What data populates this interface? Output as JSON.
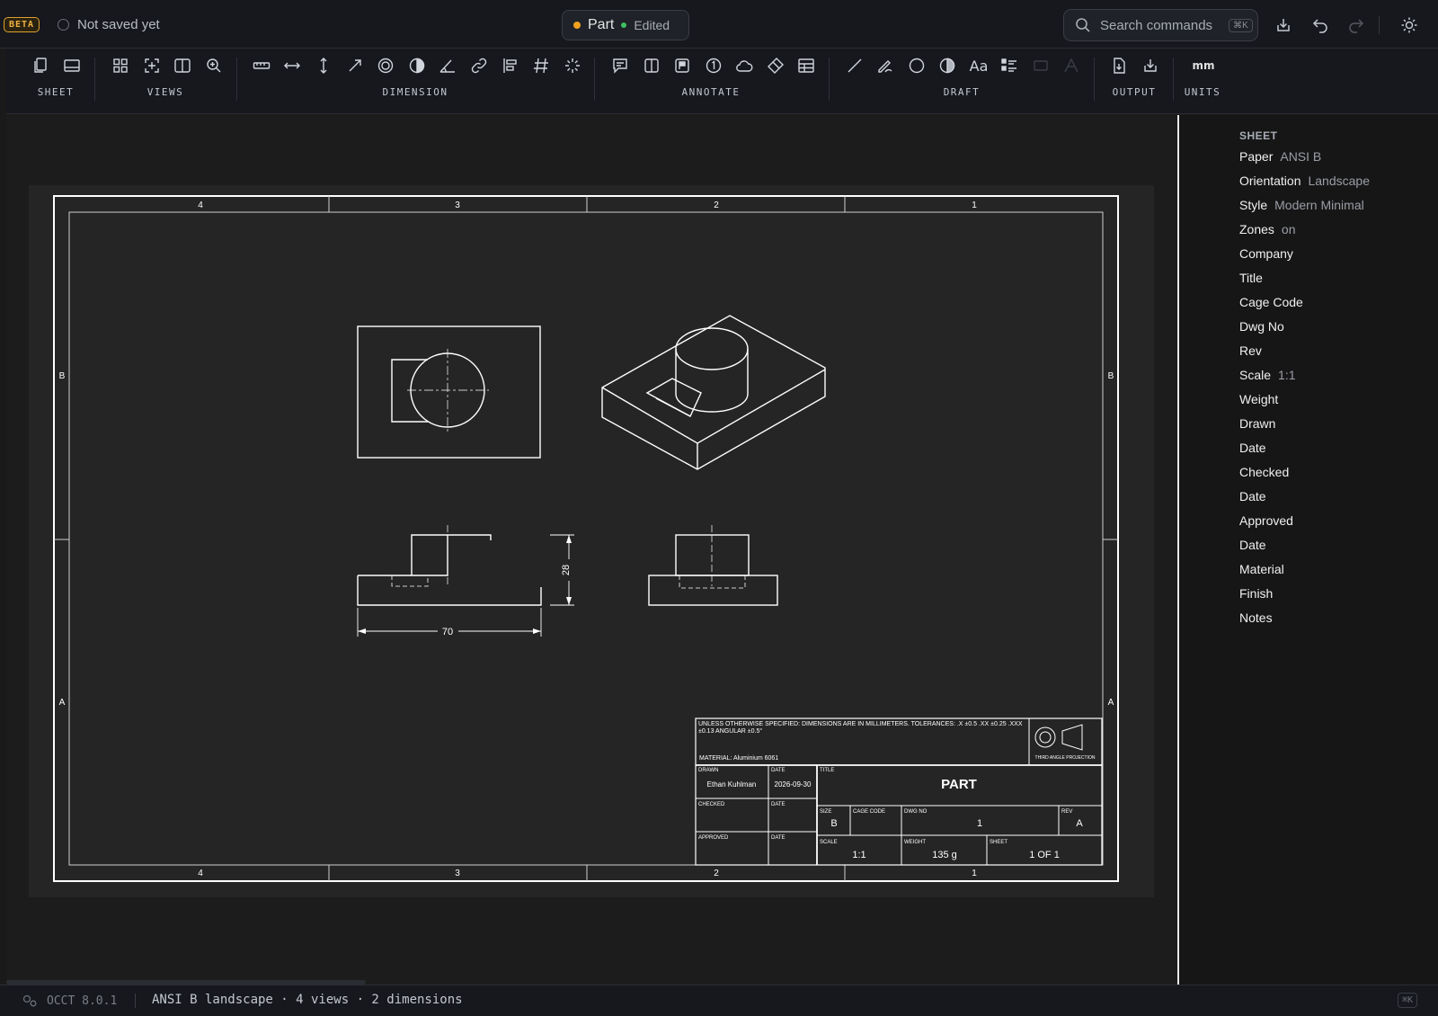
{
  "topbar": {
    "beta": "BETA",
    "save_status": "Not saved yet",
    "doc_name": "Part",
    "doc_state": "Edited",
    "search_placeholder": "Search commands",
    "search_shortcut": "⌘K",
    "icons": [
      "import-icon",
      "undo-icon",
      "redo-icon",
      "theme-icon"
    ]
  },
  "ribbon": {
    "groups": [
      {
        "label": "SHEET",
        "icons": [
          "new-sheet-icon",
          "titleblock-icon"
        ]
      },
      {
        "label": "VIEWS",
        "icons": [
          "base-views-icon",
          "projected-view-icon",
          "section-view-icon",
          "detail-view-icon"
        ]
      },
      {
        "label": "DIMENSION",
        "icons": [
          "linear-dim-icon",
          "horizontal-dim-icon",
          "vertical-dim-icon",
          "radius-dim-icon",
          "diameter-dim-icon",
          "half-dim-icon",
          "angle-dim-icon",
          "chain-dim-icon",
          "baseline-dim-icon",
          "ordinate-dim-icon",
          "auto-dim-icon"
        ]
      },
      {
        "label": "ANNOTATE",
        "icons": [
          "note-icon",
          "split-icon",
          "flag-icon",
          "balloon-icon",
          "cloud-icon",
          "tag-icon",
          "table-icon"
        ]
      },
      {
        "label": "DRAFT",
        "icons": [
          "line-icon",
          "sketch-icon",
          "circle-icon",
          "fill-icon",
          "text-icon",
          "list-icon",
          "disabled-a-icon",
          "disabled-b-icon"
        ]
      },
      {
        "label": "OUTPUT",
        "icons": [
          "export-pdf-icon",
          "download-icon"
        ]
      },
      {
        "label": "UNITS",
        "value": "mm"
      }
    ]
  },
  "sheet": {
    "zones_cols": [
      "4",
      "3",
      "2",
      "1"
    ],
    "zones_rows": [
      "B",
      "A"
    ],
    "dim_width": "70",
    "dim_height": "28",
    "titleblock": {
      "notes": "UNLESS OTHERWISE SPECIFIED: DIMENSIONS ARE IN MILLIMETERS. TOLERANCES: .X ±0.5 .XX ±0.25 .XXX ±0.13 ANGULAR ±0.5°",
      "material": "MATERIAL: Aluminium 6061",
      "projection": "THIRD ANGLE PROJECTION",
      "drawn_label": "DRAWN",
      "drawn_value": "Ethan Kuhlman",
      "date_label": "DATE",
      "date_value": "2026-09-30",
      "checked_label": "CHECKED",
      "approved_label": "APPROVED",
      "title_label": "TITLE",
      "title_value": "PART",
      "size_label": "SIZE",
      "size_value": "B",
      "cage_label": "CAGE CODE",
      "dwg_label": "DWG NO",
      "dwg_value": "1",
      "rev_label": "REV",
      "rev_value": "A",
      "scale_label": "SCALE",
      "scale_value": "1:1",
      "weight_label": "WEIGHT",
      "weight_value": "135 g",
      "sheet_label": "SHEET",
      "sheet_value": "1 OF 1"
    }
  },
  "panel": {
    "heading": "SHEET",
    "rows": [
      {
        "label": "Paper",
        "value": "ANSI B"
      },
      {
        "label": "Orientation",
        "value": "Landscape"
      },
      {
        "label": "Style",
        "value": "Modern Minimal"
      },
      {
        "label": "Zones",
        "value": "on"
      },
      {
        "label": "Company",
        "value": ""
      },
      {
        "label": "Title",
        "value": ""
      },
      {
        "label": "Cage Code",
        "value": ""
      },
      {
        "label": "Dwg No",
        "value": ""
      },
      {
        "label": "Rev",
        "value": ""
      },
      {
        "label": "Scale",
        "value": "1:1"
      },
      {
        "label": "Weight",
        "value": ""
      },
      {
        "label": "Drawn",
        "value": ""
      },
      {
        "label": "Date",
        "value": ""
      },
      {
        "label": "Checked",
        "value": ""
      },
      {
        "label": "Date",
        "value": ""
      },
      {
        "label": "Approved",
        "value": ""
      },
      {
        "label": "Date",
        "value": ""
      },
      {
        "label": "Material",
        "value": ""
      },
      {
        "label": "Finish",
        "value": ""
      },
      {
        "label": "Notes",
        "value": ""
      }
    ]
  },
  "statusbar": {
    "engine": "OCCT 8.0.1",
    "summary": "ANSI B landscape · 4 views · 2 dimensions",
    "shortcut": "⌘K"
  }
}
